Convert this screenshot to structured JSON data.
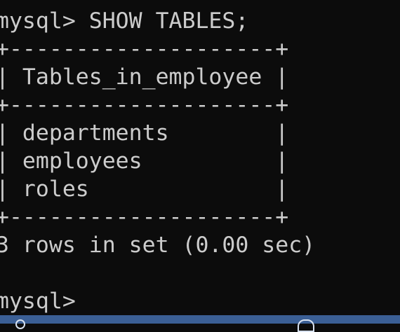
{
  "terminal": {
    "command_line": "mysql> SHOW TABLES;",
    "table_border_top": "+--------------------+",
    "table_header": "| Tables_in_employee |",
    "table_border_mid": "+--------------------+",
    "rows": [
      "| departments        |",
      "| employees          |",
      "| roles              |"
    ],
    "table_border_bottom": "+--------------------+",
    "result_summary": "3 rows in set (0.00 sec)",
    "prompt": "mysql> "
  },
  "colors": {
    "background": "#0c0c0c",
    "text": "#cccccc",
    "taskbar": "#3b5f95"
  },
  "icons": {
    "taskbar_left": "taskbar-app-icon",
    "taskbar_right": "taskbar-tray-icon"
  }
}
